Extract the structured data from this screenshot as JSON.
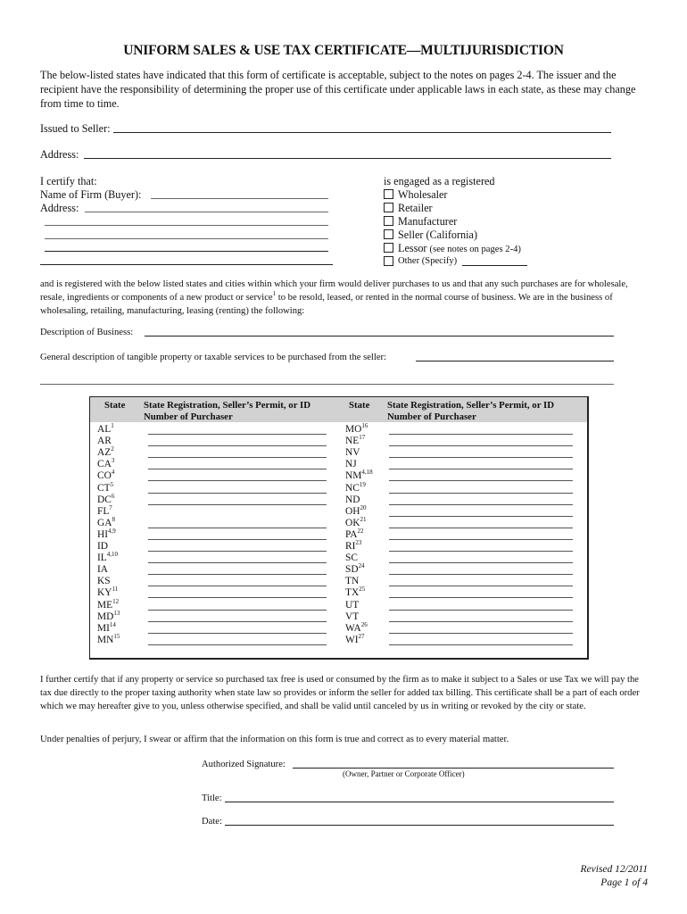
{
  "document": {
    "title": "UNIFORM SALES & USE TAX CERTIFICATE—MULTIJURISDICTION",
    "intro": "The below-listed states have indicated that this form of certificate is acceptable, subject to the notes on pages 2-4. The issuer and the recipient have the responsibility of determining the proper use of this certificate under applicable laws in each state, as these may change from time to time.",
    "issued_to_seller_label": "Issued to Seller:",
    "issued_to_seller_value": "",
    "seller_address_label": "Address:",
    "seller_address_value": "",
    "certify_label": "I certify that:",
    "firm_name_label": "Name of Firm (Buyer):",
    "firm_name_value": "",
    "buyer_address_label": "Address:",
    "buyer_address_value": "",
    "engaged_label": "is engaged as a registered",
    "business_types": [
      {
        "label": "Wholesaler",
        "checked": false
      },
      {
        "label": "Retailer",
        "checked": false
      },
      {
        "label": "Manufacturer",
        "checked": false
      },
      {
        "label": "Seller (California)",
        "checked": false
      },
      {
        "label": "Lessor",
        "note": "(see notes on pages 2-4)",
        "checked": false
      },
      {
        "label": "Other (Specify)",
        "checked": false
      }
    ],
    "registered_para_part1": "and is registered with the below listed states and cities within which your firm would deliver purchases to us and that any such purchases are for wholesale, resale, ingredients or components of a new product or service",
    "registered_para_sup": "1",
    "registered_para_part2": " to be resold, leased, or rented in the normal course of business. We are in the business of wholesaling, retailing, manufacturing, leasing (renting) the following:",
    "business_description_label": "Description of Business:",
    "business_description_value": "",
    "property_description_label": "General description of tangible property or taxable services to be purchased from the seller:",
    "property_description_value": ""
  },
  "table": {
    "headers": {
      "state": "State",
      "registration_line1": "State Registration, Seller’s Permit, or ID",
      "registration_line2": "Number of Purchaser"
    },
    "left_rows": [
      {
        "state": "AL",
        "sup": "1",
        "has_line": true
      },
      {
        "state": "AR",
        "sup": "",
        "has_line": true
      },
      {
        "state": "AZ",
        "sup": "2",
        "has_line": true
      },
      {
        "state": "CA",
        "sup": "3",
        "has_line": true
      },
      {
        "state": "CO",
        "sup": "4",
        "has_line": true
      },
      {
        "state": "CT",
        "sup": "5",
        "has_line": true
      },
      {
        "state": "DC",
        "sup": "6",
        "has_line": true
      },
      {
        "state": "FL",
        "sup": "7",
        "has_line": false
      },
      {
        "state": "GA",
        "sup": "8",
        "has_line": true
      },
      {
        "state": "HI",
        "sup": "4,9",
        "has_line": true
      },
      {
        "state": "ID",
        "sup": "",
        "has_line": true
      },
      {
        "state": "IL",
        "sup": "4,10",
        "has_line": true
      },
      {
        "state": "IA",
        "sup": "",
        "has_line": true
      },
      {
        "state": "KS",
        "sup": "",
        "has_line": true
      },
      {
        "state": "KY",
        "sup": "11",
        "has_line": true
      },
      {
        "state": "ME",
        "sup": "12",
        "has_line": true
      },
      {
        "state": "MD",
        "sup": "13",
        "has_line": true
      },
      {
        "state": "MI",
        "sup": "14",
        "has_line": true
      },
      {
        "state": "MN",
        "sup": "15",
        "has_line": true
      }
    ],
    "right_rows": [
      {
        "state": "MO",
        "sup": "16",
        "has_line": true
      },
      {
        "state": "NE",
        "sup": "17",
        "has_line": true
      },
      {
        "state": "NV",
        "sup": "",
        "has_line": true
      },
      {
        "state": "NJ",
        "sup": "",
        "has_line": true
      },
      {
        "state": "NM",
        "sup": "4,18",
        "has_line": true
      },
      {
        "state": "NC",
        "sup": "19",
        "has_line": true
      },
      {
        "state": "ND",
        "sup": "",
        "has_line": true
      },
      {
        "state": "OH",
        "sup": "20",
        "has_line": true
      },
      {
        "state": "OK",
        "sup": "21",
        "has_line": true
      },
      {
        "state": "PA",
        "sup": "22",
        "has_line": true
      },
      {
        "state": "RI",
        "sup": "23",
        "has_line": true
      },
      {
        "state": "SC",
        "sup": "",
        "has_line": true
      },
      {
        "state": "SD",
        "sup": "24",
        "has_line": true
      },
      {
        "state": "TN",
        "sup": "",
        "has_line": true
      },
      {
        "state": "TX",
        "sup": "25",
        "has_line": true
      },
      {
        "state": "UT",
        "sup": "",
        "has_line": true
      },
      {
        "state": "VT",
        "sup": "",
        "has_line": true
      },
      {
        "state": "WA",
        "sup": "26",
        "has_line": true
      },
      {
        "state": "WI",
        "sup": "27",
        "has_line": true
      }
    ]
  },
  "certification": {
    "further_certify": "I further certify that if any property or service so purchased tax free is used or consumed by the firm as to make it subject to a Sales or use Tax  we will pay the tax due directly to the proper taxing authority when state law so provides or inform the seller for added tax billing. This certificate shall be a part of each order which we may hereafter give to you, unless otherwise specified, and shall be valid until canceled by us in writing or revoked by the city or state.",
    "perjury": "Under penalties of perjury, I swear or affirm that the information on this form is true and correct as to every material matter.",
    "signature_label": "Authorized Signature:",
    "signature_note": "(Owner, Partner or Corporate Officer)",
    "title_label": "Title:",
    "date_label": "Date:"
  },
  "footer": {
    "revised": "Revised 12/2011",
    "page": "Page 1 of 4"
  }
}
